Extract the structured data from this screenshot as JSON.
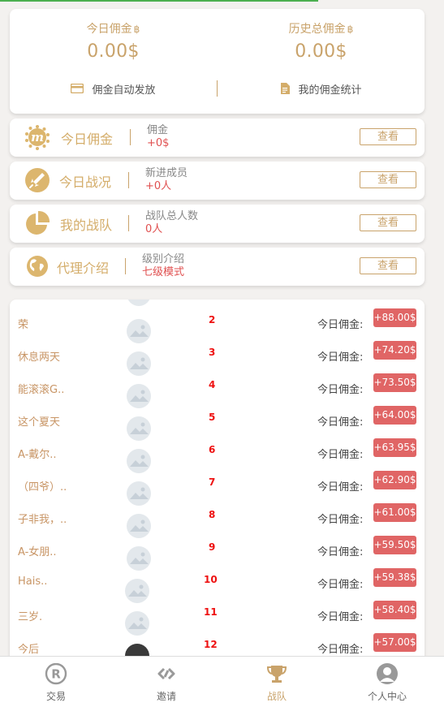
{
  "summary": {
    "today_label": "今日佣金",
    "today_value": "0.00$",
    "history_label": "历史总佣金",
    "history_value": "0.00$",
    "btc_symbol": "฿",
    "auto_pay_label": "佣金自动发放",
    "stats_label": "我的佣金统计"
  },
  "rows": [
    {
      "title": "今日佣金",
      "sub_label": "佣金",
      "sub_value": "+0$",
      "button": "查看",
      "icon": "m-coin-icon"
    },
    {
      "title": "今日战况",
      "sub_label": "新进成员",
      "sub_value": "+0人",
      "button": "查看",
      "icon": "rocket-icon"
    },
    {
      "title": "我的战队",
      "sub_label": "战队总人数",
      "sub_value": "0人",
      "button": "查看",
      "icon": "pie-chart-icon"
    },
    {
      "title": "代理介绍",
      "sub_label": "级别介绍",
      "sub_value": "七级模式",
      "button": "查看",
      "icon": "globe-icon"
    }
  ],
  "ranking": {
    "value_label": "今日佣金:",
    "items": [
      {
        "name": "荣",
        "rank": "2",
        "value": "+88.00$"
      },
      {
        "name": "休息两天",
        "rank": "3",
        "value": "+74.20$"
      },
      {
        "name": "能滚滚G..",
        "rank": "4",
        "value": "+73.50$"
      },
      {
        "name": "这个夏天",
        "rank": "5",
        "value": "+64.00$"
      },
      {
        "name": "A-戴尔..",
        "rank": "6",
        "value": "+63.95$"
      },
      {
        "name": "（四爷）..",
        "rank": "7",
        "value": "+62.90$"
      },
      {
        "name": "子非我，..",
        "rank": "8",
        "value": "+61.00$"
      },
      {
        "name": "A-女朋..",
        "rank": "9",
        "value": "+59.50$"
      },
      {
        "name": "Hais..",
        "rank": "10",
        "value": "+59.38$"
      },
      {
        "name": "三岁.",
        "rank": "11",
        "value": "+58.40$"
      },
      {
        "name": "今后",
        "rank": "12",
        "value": "+57.00$"
      }
    ]
  },
  "tabbar": {
    "tabs": [
      {
        "label": "交易",
        "icon": "registered-icon"
      },
      {
        "label": "邀请",
        "icon": "link-icon"
      },
      {
        "label": "战队",
        "icon": "trophy-icon",
        "active": true
      },
      {
        "label": "个人中心",
        "icon": "user-icon"
      }
    ]
  },
  "colors": {
    "accent": "#c9a36b",
    "red": "#e06565",
    "rank_red": "#ee1111"
  }
}
